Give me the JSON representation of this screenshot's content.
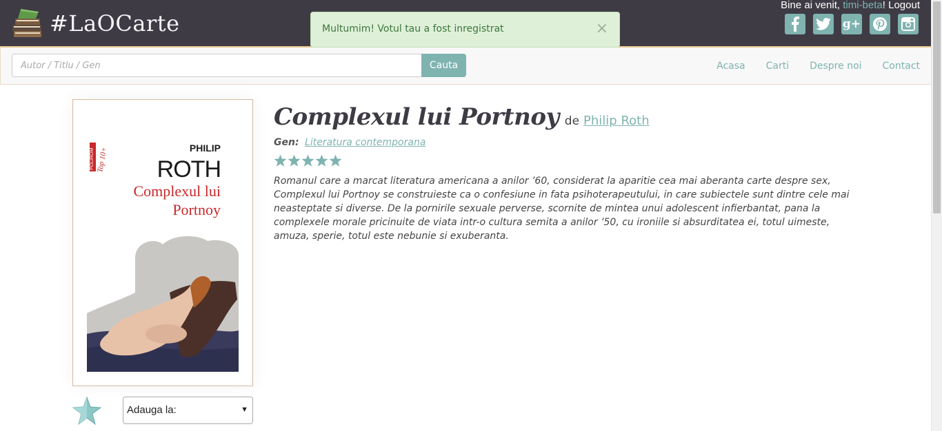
{
  "header": {
    "logo_text": "#LaOCarte",
    "welcome_prefix": "Bine ai venit, ",
    "username": "timi-beta",
    "welcome_sep": "! ",
    "logout": "Logout",
    "social": [
      {
        "name": "facebook-icon",
        "glyph": "f"
      },
      {
        "name": "twitter-icon",
        "glyph": "t"
      },
      {
        "name": "google-plus-icon",
        "glyph": "g+"
      },
      {
        "name": "pinterest-icon",
        "glyph": "p"
      },
      {
        "name": "instagram-icon",
        "glyph": "◘"
      }
    ]
  },
  "alert": {
    "message": "Multumim! Votul tau a fost inregistrat",
    "close": "×"
  },
  "search": {
    "placeholder": "Autor / Titlu / Gen",
    "button": "Cauta"
  },
  "nav": {
    "items": [
      "Acasa",
      "Carti",
      "Despre noi",
      "Contact"
    ]
  },
  "book": {
    "title": "Complexul lui Portnoy",
    "by": "de",
    "author": "Philip Roth",
    "genre_label": "Gen:",
    "genre": "Literatura contemporana",
    "rating": 5,
    "description": "Romanul care a marcat literatura americana a anilor ’60, considerat la aparitie cea mai aberanta carte despre sex, Complexul lui Portnoy se construieste ca o confesiune in fata psihoterapeutului, in care subiectele sunt dintre cele mai neasteptate si diverse. De la pornirile sexuale perverse, scornite de mintea unui adolescent infierbantat, pana la complexele morale pricinuite de viata intr-o cultura semita a anilor ’50, cu ironiile si absurditatea ei, totul uimeste, amuza, sperie, totul este nebunie si exuberanta.",
    "cover": {
      "publisher": "POLIROM",
      "series": "Top 10+",
      "author_first": "PHILIP",
      "author_last": "ROTH",
      "title_line1": "Complexul lui",
      "title_line2": "Portnoy"
    }
  },
  "actions": {
    "add_to_label": "Adauga la:",
    "arrow": "▼"
  },
  "colors": {
    "accent": "#7fb3b0",
    "header_bg": "#3e3b45",
    "alert_bg": "#dff0d8"
  }
}
